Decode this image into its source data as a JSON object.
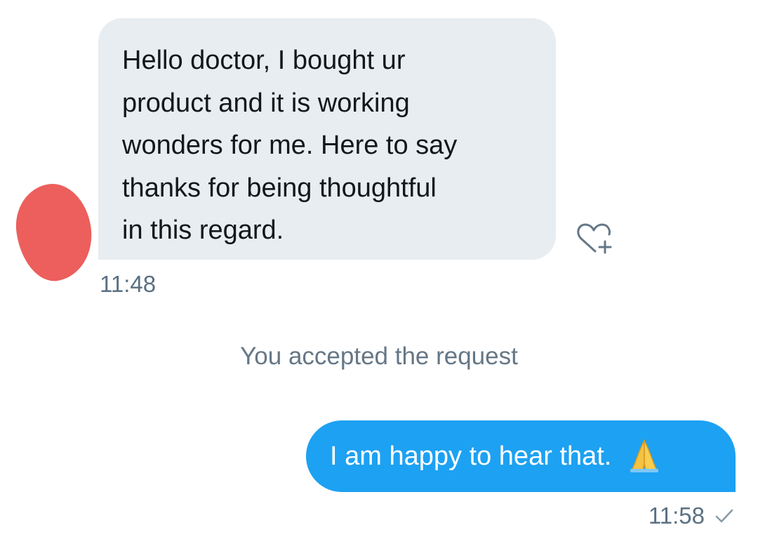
{
  "conversation": {
    "incoming": {
      "text": "Hello doctor, I bought ur\nproduct and it is working\nwonders for me. Here to say\nthanks for being thoughtful\nin this regard.",
      "time": "11:48",
      "like_icon": "heart-plus-icon"
    },
    "system_message": "You accepted the request",
    "outgoing": {
      "text": "I am happy to hear that. ",
      "emoji": "folded-hands-emoji",
      "time": "11:58",
      "status_icon": "check-icon"
    }
  },
  "colors": {
    "incoming_bubble": "#e8edf1",
    "outgoing_bubble": "#1da1f2",
    "avatar_redaction": "#ec5f5c",
    "timestamp": "#5b7083"
  }
}
